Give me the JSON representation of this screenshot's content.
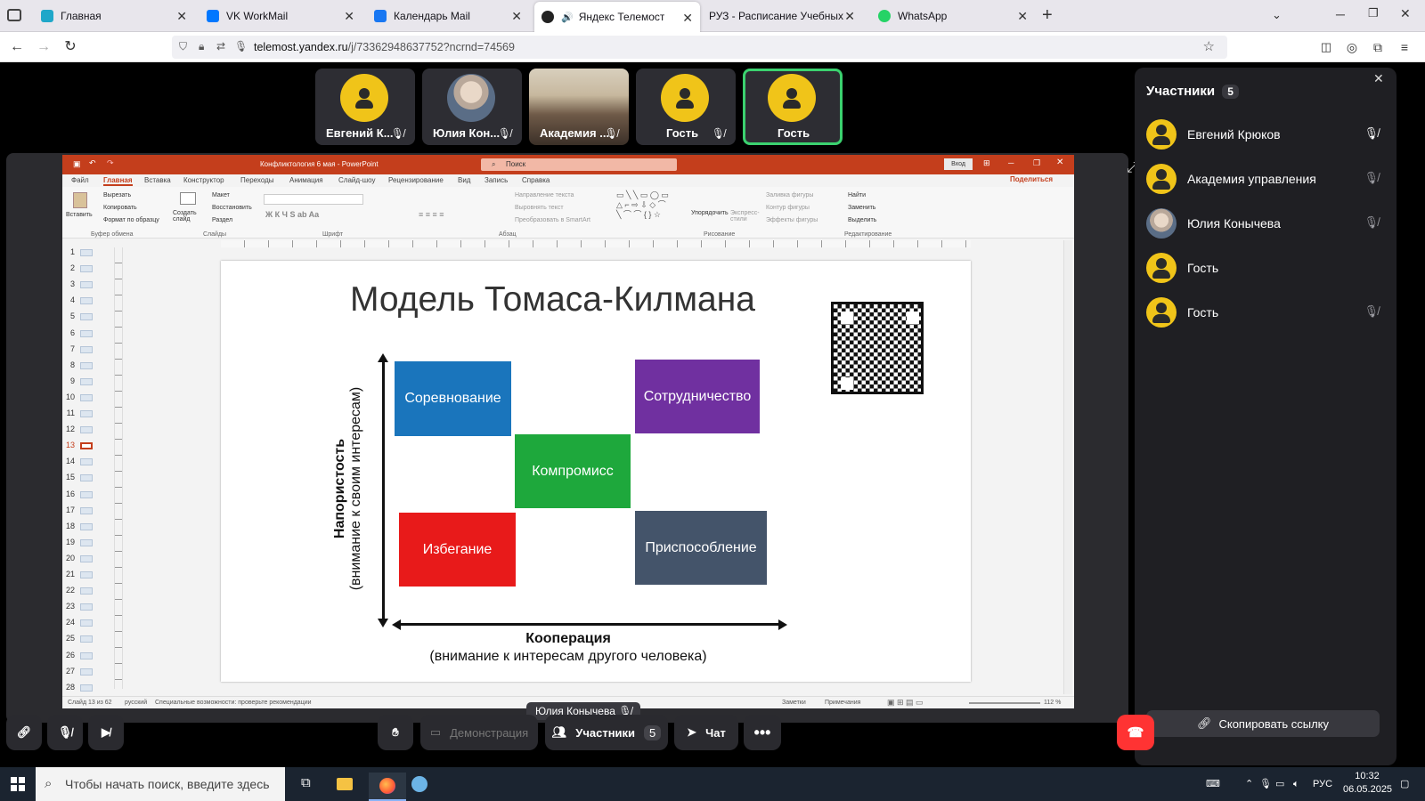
{
  "browser": {
    "tabs": [
      {
        "title": "Главная",
        "color": "#1fa7c9",
        "left": 0
      },
      {
        "title": "VK WorkMail",
        "color": "#0077ff",
        "left": 0
      },
      {
        "title": "Календарь Mail",
        "color": "#1877f2",
        "left": 0
      },
      {
        "title": "Яндекс Телемост",
        "color": "#222222",
        "left": 0,
        "active": true
      },
      {
        "title": "РУЗ - Расписание Учебных Заняти",
        "color": "#cccccc",
        "left": 0
      },
      {
        "title": "WhatsApp",
        "color": "#25d366",
        "left": 0
      }
    ],
    "new_tab": "+",
    "url_host": "telemost.yandex.ru",
    "url_path": "/j/73362948637752?ncrnd=74569"
  },
  "tiles": [
    {
      "name": "Евгений К...",
      "avatar": "person"
    },
    {
      "name": "Юлия Кон...",
      "avatar": "photo"
    },
    {
      "name": "Академия ...",
      "avatar": "room"
    },
    {
      "name": "Гость",
      "avatar": "person"
    },
    {
      "name": "Гость",
      "avatar": "person",
      "speaking": true
    }
  ],
  "ppt": {
    "title": "Конфликтология 6 мая  -  PowerPoint",
    "search": "Поиск",
    "login": "Вход",
    "share": "Поделиться",
    "tabs": [
      "Файл",
      "Главная",
      "Вставка",
      "Конструктор",
      "Переходы",
      "Анимация",
      "Слайд-шоу",
      "Рецензирование",
      "Вид",
      "Запись",
      "Справка"
    ],
    "groups": [
      "Буфер обмена",
      "Слайды",
      "Шрифт",
      "Абзац",
      "Рисование",
      "Редактирование"
    ],
    "ribbon_items": {
      "paste": "Вставить",
      "cut": "Вырезать",
      "copy": "Копировать",
      "format": "Формат по образцу",
      "new_slide": "Создать слайд",
      "layout": "Макет",
      "reset": "Восстановить",
      "section": "Раздел",
      "text_dir": "Направление текста",
      "align_text": "Выровнять текст",
      "smartart": "Преобразовать в SmartArt",
      "arrange": "Упорядочить",
      "quick_styles": "Экспресс-стили",
      "fill": "Заливка фигуры",
      "outline": "Контур фигуры",
      "effects": "Эффекты фигуры",
      "find": "Найти",
      "replace": "Заменить",
      "select": "Выделить"
    },
    "slide_numbers": [
      "1",
      "2",
      "3",
      "4",
      "5",
      "6",
      "7",
      "8",
      "9",
      "10",
      "11",
      "12",
      "13",
      "14",
      "15",
      "16",
      "17",
      "18",
      "19",
      "20",
      "21",
      "22",
      "23",
      "24",
      "25",
      "26",
      "27",
      "28"
    ],
    "current_slide": "13",
    "status_left": "Слайд 13 из 62",
    "status_lang": "русский",
    "status_access": "Специальные возможности: проверьте рекомендации",
    "status_notes": "Заметки",
    "status_comments": "Примечания",
    "zoom": "112 %"
  },
  "slide": {
    "title": "Модель Томаса-Килмана",
    "boxes": {
      "competition": "Соревнование",
      "collaboration": "Сотрудничество",
      "compromise": "Компромисс",
      "avoidance": "Избегание",
      "accommodation": "Приспособление"
    },
    "y_axis_label": "Напористость",
    "y_axis_sub": "(внимание к своим интересам)",
    "x_axis_label": "Кооперация",
    "x_axis_sub": "(внимание к интересам другого человека)",
    "colors": {
      "competition": "#1a75bc",
      "collaboration": "#7030a0",
      "compromise": "#1ea83c",
      "avoidance": "#e81a1a",
      "accommodation": "#44546a"
    }
  },
  "speaker_label": "Юлия Конычева",
  "panel": {
    "title": "Участники",
    "count": "5",
    "participants": [
      {
        "name": "Евгений Крюков",
        "avatar": "person"
      },
      {
        "name": "Академия управления",
        "avatar": "person"
      },
      {
        "name": "Юлия Конычева",
        "avatar": "photo"
      },
      {
        "name": "Гость",
        "avatar": "person"
      },
      {
        "name": "Гость",
        "avatar": "person"
      }
    ],
    "copy_link": "Скопировать ссылку"
  },
  "controls": {
    "demo": "Демонстрация",
    "participants": "Участники",
    "participants_count": "5",
    "chat": "Чат"
  },
  "taskbar": {
    "search": "Чтобы начать поиск, введите здесь запрос",
    "lang": "РУС",
    "time": "10:32",
    "date": "06.05.2025"
  }
}
